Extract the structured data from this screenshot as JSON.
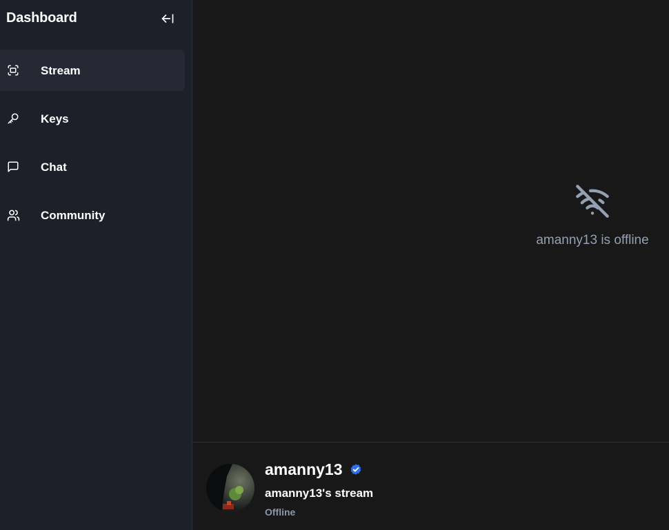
{
  "sidebar": {
    "title": "Dashboard",
    "collapse_icon": "arrow-left-to-line-icon",
    "items": [
      {
        "label": "Stream",
        "icon": "fullscreen-scan-icon",
        "active": true
      },
      {
        "label": "Keys",
        "icon": "key-icon",
        "active": false
      },
      {
        "label": "Chat",
        "icon": "message-square-icon",
        "active": false
      },
      {
        "label": "Community",
        "icon": "users-icon",
        "active": false
      }
    ]
  },
  "player": {
    "status_icon": "wifi-off-icon",
    "offline_message": "amanny13 is offline"
  },
  "stream_info": {
    "username": "amanny13",
    "verified_icon": "verified-badge-icon",
    "stream_title": "amanny13's stream",
    "status": "Offline"
  },
  "colors": {
    "sidebar_bg": "#1e2029",
    "active_item_bg": "#262833",
    "main_bg": "#181818",
    "muted_text": "#94a0b4",
    "verified_blue": "#2f6fe8"
  }
}
